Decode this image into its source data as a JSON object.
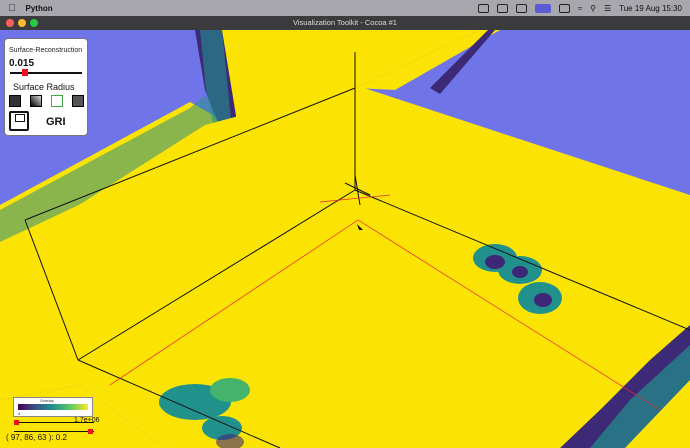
{
  "menubar": {
    "apple_icon": "apple-logo-icon",
    "app_name": "Python",
    "clock": "Tue 19 Aug  15:30"
  },
  "window": {
    "title": "Visualization Toolkit - Cocoa #1",
    "lights": [
      "#ff5f57",
      "#febc2e",
      "#28c840"
    ]
  },
  "panel": {
    "slider_label": "Surface-Reconstruction",
    "slider_value": "0.015",
    "slider_fraction": 0.1,
    "heading": "Surface Radius",
    "save_label": "GRI"
  },
  "legend": {
    "title": "Overlay",
    "tick": "0"
  },
  "slider2_value": "1.7e+06",
  "coord_readout": "( 97, 86, 63 ): 0.2",
  "colors": {
    "plane": "#fbe303",
    "background": "#6f75e8",
    "blob_dark": "#3f2778",
    "blob_teal": "#1f8f86",
    "blob_green": "#45b36c"
  }
}
